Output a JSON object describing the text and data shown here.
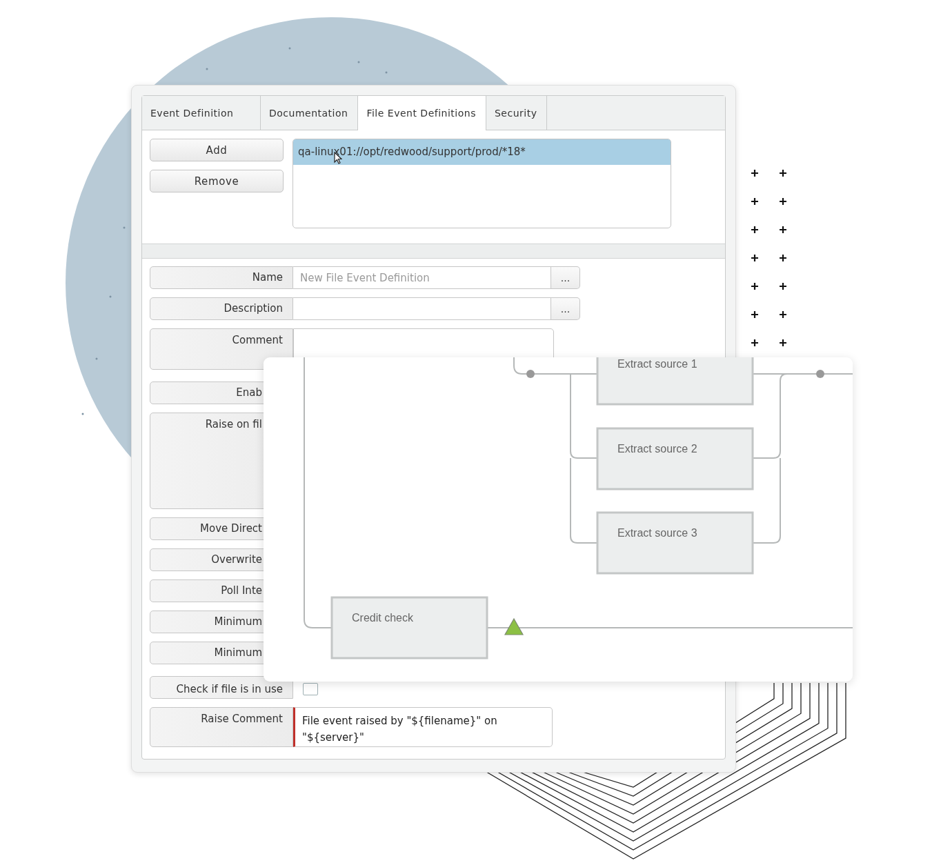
{
  "tabs": [
    {
      "label": "Event Definition",
      "selected": false
    },
    {
      "label": "Documentation",
      "selected": false
    },
    {
      "label": "File Event Definitions",
      "selected": true
    },
    {
      "label": "Security",
      "selected": false
    }
  ],
  "buttons": [
    {
      "label": "Add"
    },
    {
      "label": "Remove"
    }
  ],
  "file_list": {
    "items": [
      {
        "text": "qa-linux01://opt/redwood/support/prod/*18*",
        "selected": true
      }
    ]
  },
  "form": {
    "rows": [
      {
        "kind": "field-more",
        "label": "Name",
        "placeholder": "New File Event Definition",
        "more": "..."
      },
      {
        "kind": "field-more",
        "label": "Description",
        "more": "..."
      },
      {
        "kind": "textarea",
        "label": "Comment"
      },
      {
        "kind": "covered",
        "label": "Enab"
      },
      {
        "kind": "covered-tall",
        "label": "Raise on fil"
      },
      {
        "kind": "covered",
        "label": "Move Direct"
      },
      {
        "kind": "covered",
        "label": "Overwrite"
      },
      {
        "kind": "covered",
        "label": "Poll Inte"
      },
      {
        "kind": "covered",
        "label": "Minimum"
      },
      {
        "kind": "covered",
        "label": "Minimum"
      },
      {
        "kind": "checkbox",
        "label": "Check if file is in use",
        "checked": false
      },
      {
        "kind": "comment",
        "label": "Raise Comment",
        "value": "File event raised by \"${filename}\" on \"${server}\"",
        "required": true
      }
    ]
  },
  "diagram": {
    "nodes": [
      {
        "label": "Extract source 1"
      },
      {
        "label": "Extract source 2"
      },
      {
        "label": "Extract source 3"
      },
      {
        "label": "Credit check"
      }
    ]
  }
}
